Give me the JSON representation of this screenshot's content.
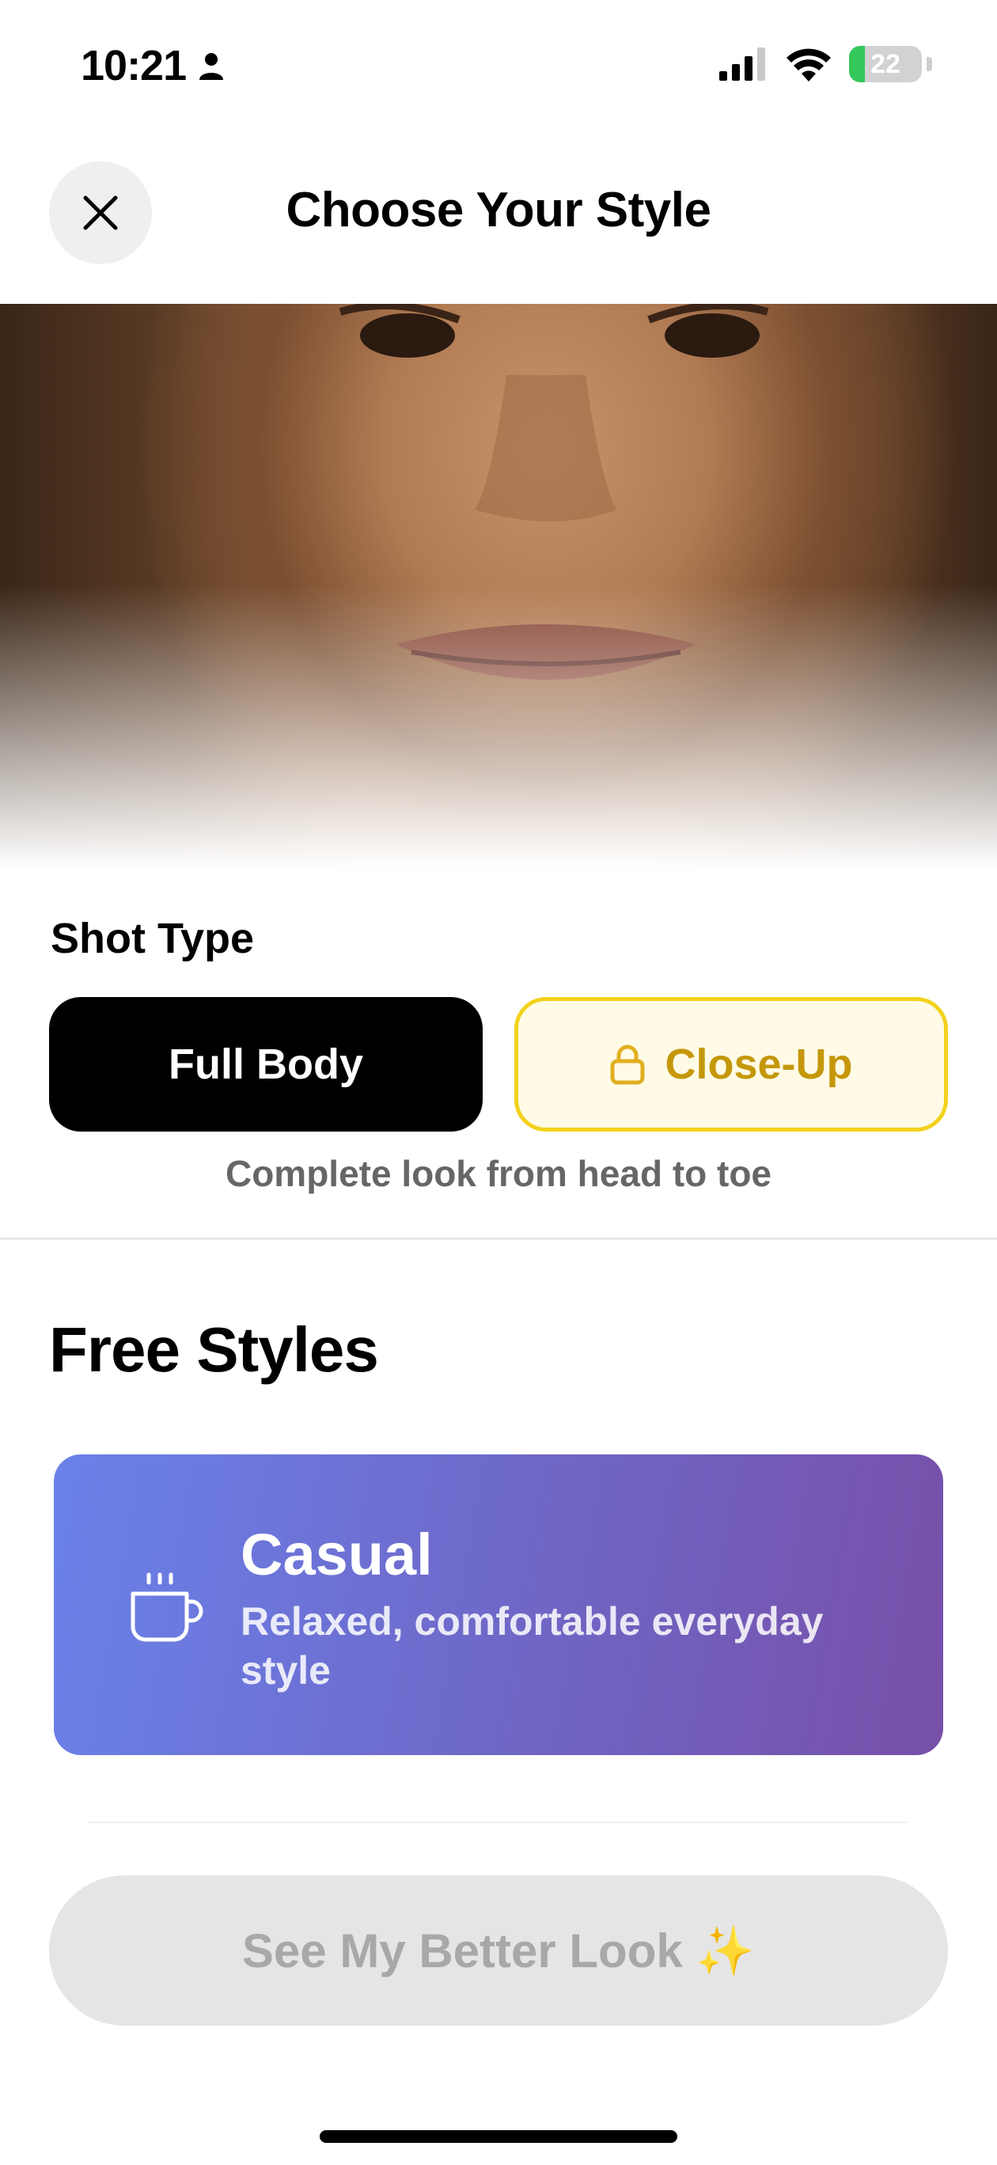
{
  "status_bar": {
    "time": "10:21",
    "battery": "22",
    "battery_fraction": 0.22
  },
  "header": {
    "title": "Choose Your Style"
  },
  "shot_type": {
    "label": "Shot Type",
    "options": [
      {
        "label": "Full Body",
        "selected": true,
        "locked": false
      },
      {
        "label": "Close-Up",
        "selected": false,
        "locked": true
      }
    ],
    "caption": "Complete look from head to toe"
  },
  "free_styles": {
    "title": "Free Styles",
    "cards": [
      {
        "title": "Casual",
        "description": "Relaxed, comfortable everyday style",
        "icon": "coffee-cup-icon"
      }
    ]
  },
  "cta": {
    "label": "See My Better Look ✨",
    "enabled": false
  },
  "colors": {
    "selected_button": "#000000",
    "locked_accent": "#c5970a",
    "locked_border": "#f3d21b",
    "card_gradient_start": "#6a82ea",
    "card_gradient_end": "#774fa8",
    "battery_fill": "#34c759"
  }
}
